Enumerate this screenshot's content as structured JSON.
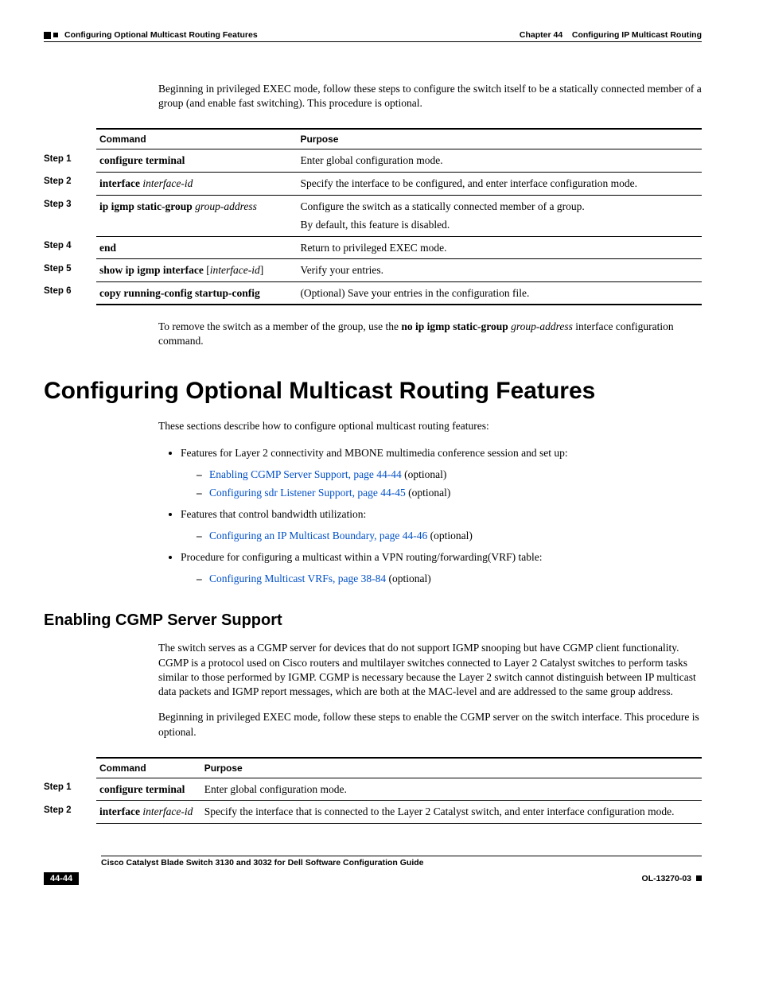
{
  "header": {
    "left": "Configuring Optional Multicast Routing Features",
    "right_prefix": "Chapter 44",
    "right_title": "Configuring IP Multicast Routing"
  },
  "intro1": "Beginning in privileged EXEC mode, follow these steps to configure the switch itself to be a statically connected member of a group (and enable fast switching). This procedure is optional.",
  "table1": {
    "head_cmd": "Command",
    "head_purpose": "Purpose",
    "rows": [
      {
        "step": "Step 1",
        "cmd_bold": "configure terminal",
        "cmd_italic": "",
        "cmd_extra": "",
        "purpose": "Enter global configuration mode."
      },
      {
        "step": "Step 2",
        "cmd_bold": "interface",
        "cmd_italic": " interface-id",
        "cmd_extra": "",
        "purpose": "Specify the interface to be configured, and enter interface configuration mode."
      },
      {
        "step": "Step 3",
        "cmd_bold": "ip igmp static-group",
        "cmd_italic": " group-address",
        "cmd_extra": "",
        "purpose": "Configure the switch as a statically connected member of a group.",
        "purpose2": "By default, this feature is disabled."
      },
      {
        "step": "Step 4",
        "cmd_bold": "end",
        "cmd_italic": "",
        "cmd_extra": "",
        "purpose": "Return to privileged EXEC mode."
      },
      {
        "step": "Step 5",
        "cmd_bold": "show ip igmp interface",
        "cmd_italic": "interface-id",
        "cmd_extra": "brackets",
        "purpose": "Verify your entries."
      },
      {
        "step": "Step 6",
        "cmd_bold": "copy running-config startup-config",
        "cmd_italic": "",
        "cmd_extra": "",
        "purpose": "(Optional) Save your entries in the configuration file."
      }
    ]
  },
  "remove_text_pre": "To remove the switch as a member of the group, use the ",
  "remove_text_bold": "no ip igmp static-group",
  "remove_text_italic": " group-address",
  "remove_text_post": " interface configuration command.",
  "h1": "Configuring Optional Multicast Routing Features",
  "intro2": "These sections describe how to configure optional multicast routing features:",
  "bullets": {
    "b1": "Features for Layer 2 connectivity and MBONE multimedia conference session and set up:",
    "b1_d1_link": "Enabling CGMP Server Support, page 44-44",
    "b1_d1_post": " (optional)",
    "b1_d2_link": "Configuring sdr Listener Support, page 44-45",
    "b1_d2_post": " (optional)",
    "b2": "Features that control bandwidth utilization:",
    "b2_d1_link": "Configuring an IP Multicast Boundary, page 44-46",
    "b2_d1_post": " (optional)",
    "b3": "Procedure for configuring a multicast within a VPN routing/forwarding(VRF) table:",
    "b3_d1_link": "Configuring Multicast VRFs, page 38-84",
    "b3_d1_post": " (optional)"
  },
  "h2": "Enabling CGMP Server Support",
  "cgmp_p1": "The switch serves as a CGMP server for devices that do not support IGMP snooping but have CGMP client functionality. CGMP is a protocol used on Cisco routers and multilayer switches connected to Layer 2 Catalyst switches to perform tasks similar to those performed by IGMP. CGMP is necessary because the Layer 2 switch cannot distinguish between IP multicast data packets and IGMP report messages, which are both at the MAC-level and are addressed to the same group address.",
  "cgmp_p2": "Beginning in privileged EXEC mode, follow these steps to enable the CGMP server on the switch interface. This procedure is optional.",
  "table2": {
    "head_cmd": "Command",
    "head_purpose": "Purpose",
    "rows": [
      {
        "step": "Step 1",
        "cmd_bold": "configure terminal",
        "cmd_italic": "",
        "purpose": "Enter global configuration mode."
      },
      {
        "step": "Step 2",
        "cmd_bold": "interface",
        "cmd_italic": " interface-id",
        "purpose": "Specify the interface that is connected to the Layer 2 Catalyst switch, and enter interface configuration mode."
      }
    ]
  },
  "footer": {
    "title": "Cisco Catalyst Blade Switch 3130 and 3032 for Dell Software Configuration Guide",
    "page": "44-44",
    "doc": "OL-13270-03"
  }
}
